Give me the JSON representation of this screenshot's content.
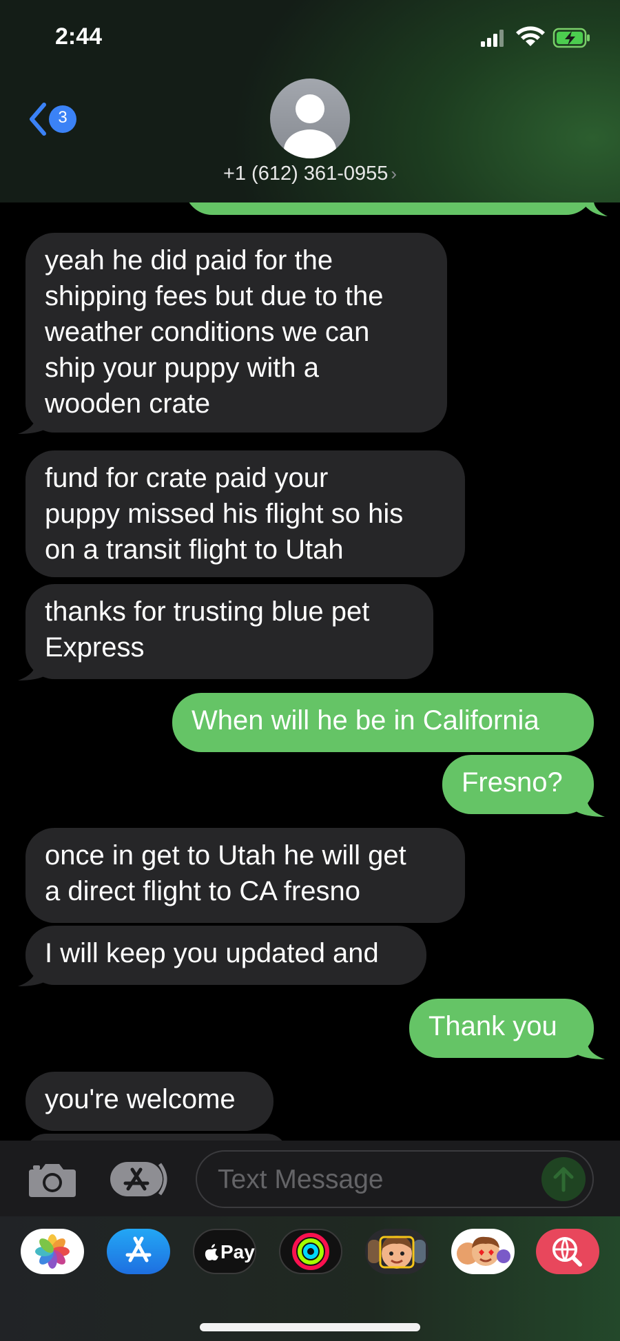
{
  "status_bar": {
    "time": "2:44"
  },
  "header": {
    "back_badge": "3",
    "contact": "+1 (612) 361-0955"
  },
  "messages": [
    {
      "side": "incoming",
      "text": "yeah he did paid for the\nshipping fees but due to the\nweather conditions we can\nship your puppy with a\nwooden crate"
    },
    {
      "side": "incoming",
      "text": "fund for crate paid your\npuppy missed his flight so his\non a transit flight to Utah"
    },
    {
      "side": "incoming",
      "text": "thanks for trusting blue pet\nExpress"
    },
    {
      "side": "outgoing",
      "text": "When will he be in California"
    },
    {
      "side": "outgoing",
      "text": "Fresno?"
    },
    {
      "side": "incoming",
      "text": "once in get to Utah he will get\na direct flight to CA fresno"
    },
    {
      "side": "incoming",
      "text": "I will keep you updated and"
    },
    {
      "side": "outgoing",
      "text": "Thank you"
    },
    {
      "side": "incoming",
      "text": "you're welcome"
    }
  ],
  "composer": {
    "placeholder": "Text Message"
  },
  "app_drawer": {
    "items": [
      {
        "name": "photos-app",
        "icon": "photos-icon"
      },
      {
        "name": "app-store-app",
        "icon": "app-store-icon"
      },
      {
        "name": "apple-pay-app",
        "icon": "apple-pay-icon",
        "label": "Pay"
      },
      {
        "name": "fitness-app",
        "icon": "activity-rings-icon"
      },
      {
        "name": "memoji-app",
        "icon": "memoji-icon"
      },
      {
        "name": "animoji-stickers-app",
        "icon": "memoji-stickers-icon"
      },
      {
        "name": "search-images-app",
        "icon": "globe-search-icon"
      }
    ]
  },
  "colors": {
    "outgoing_bubble": "#65c466",
    "incoming_bubble": "#262628",
    "accent_blue": "#3b82f6"
  }
}
